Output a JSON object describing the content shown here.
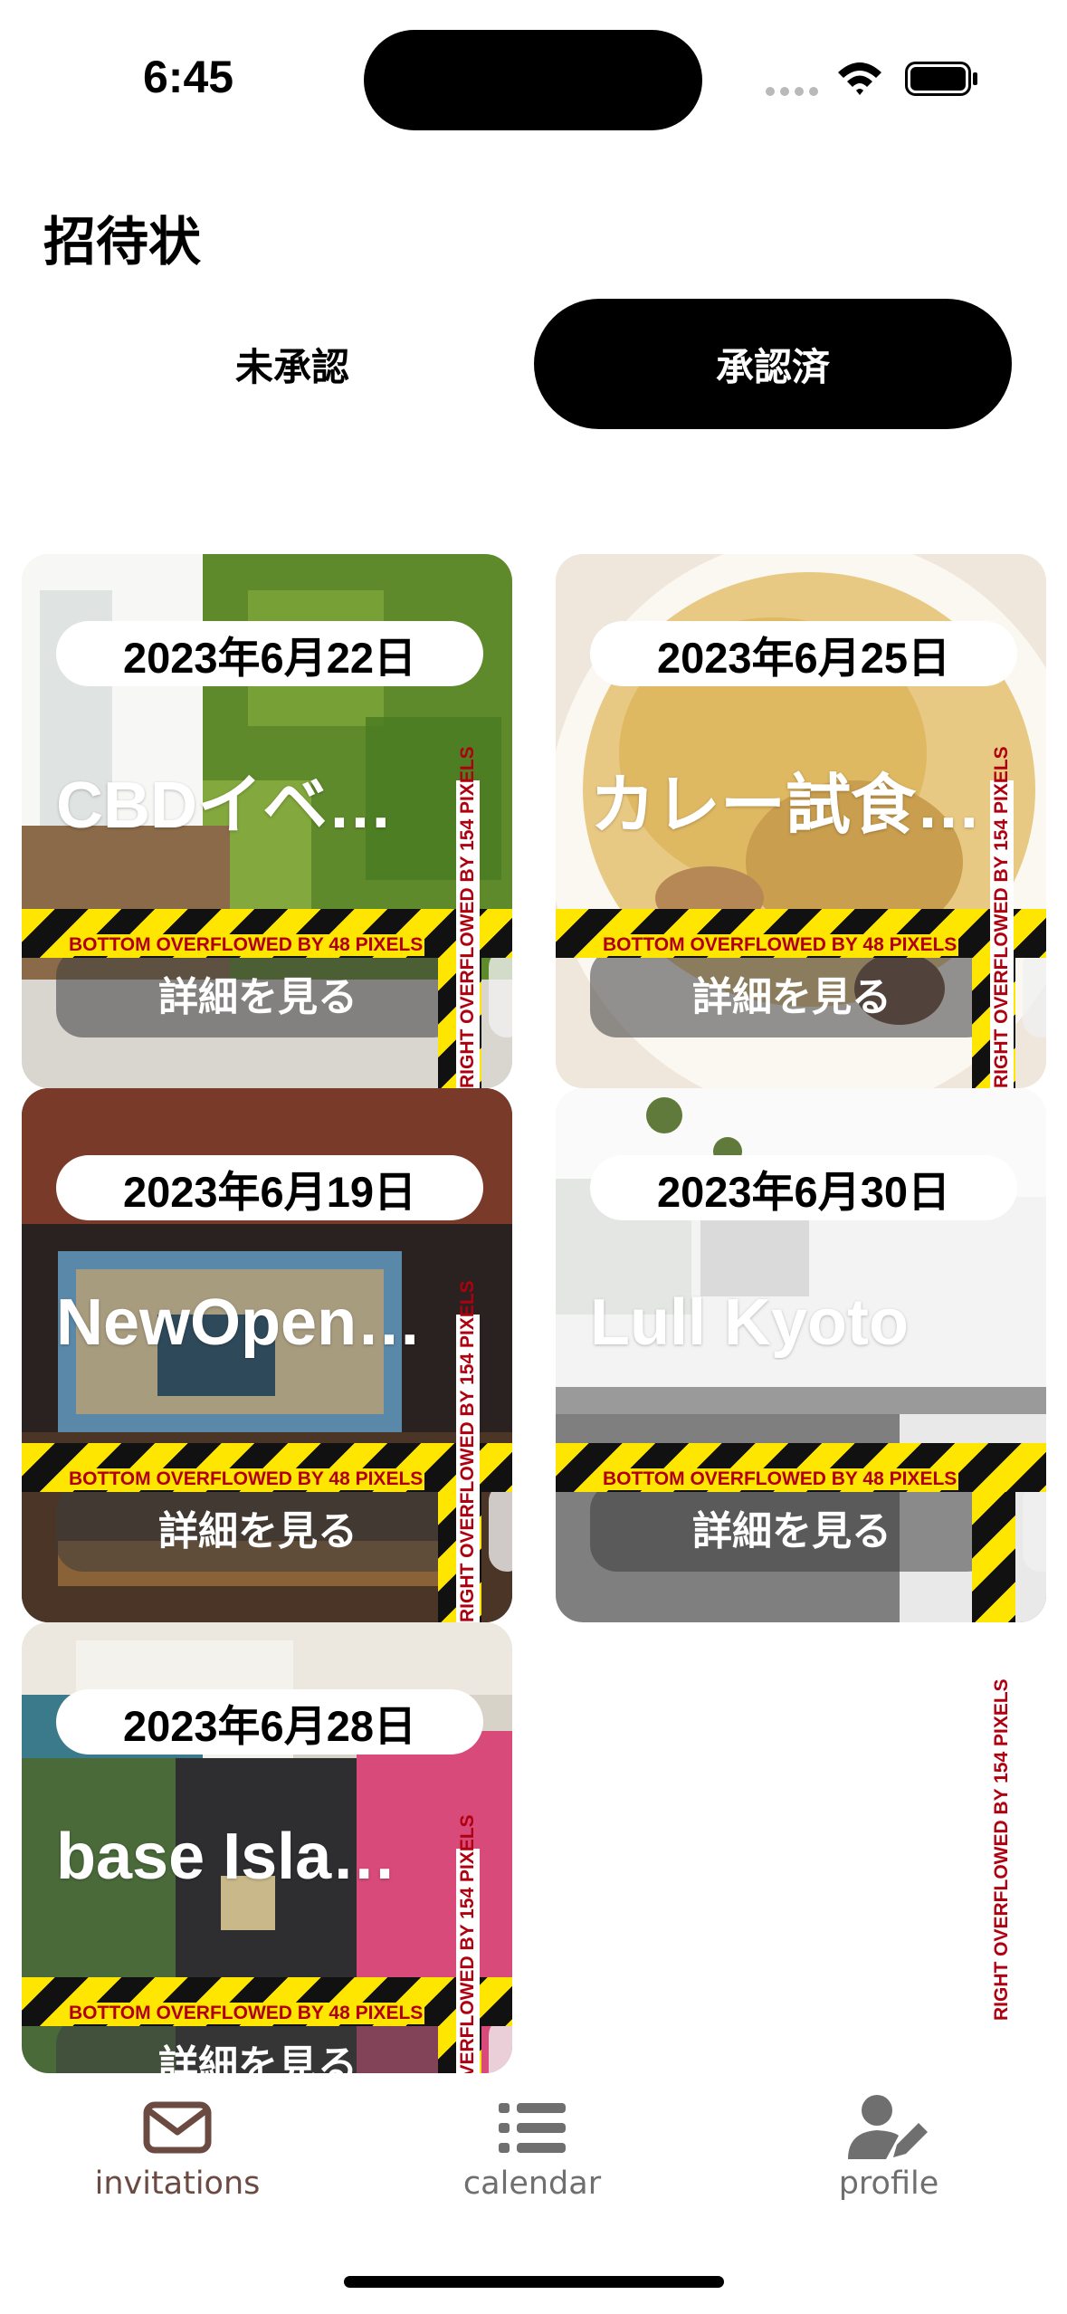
{
  "status": {
    "time": "6:45"
  },
  "header": {
    "title": "招待状"
  },
  "tabs": {
    "pending": "未承認",
    "approved": "承認済"
  },
  "cards": [
    {
      "date": "2023年6月22日",
      "title": "CBDイベ…",
      "button": "詳細を見る",
      "image": "cafe-green-wall"
    },
    {
      "date": "2023年6月25日",
      "title": "カレー試食…",
      "button": "詳細を見る",
      "image": "pasta-dish"
    },
    {
      "date": "2023年6月19日",
      "title": "NewOpen…",
      "button": "詳細を見る",
      "image": "cafe-bohemia-interior"
    },
    {
      "date": "2023年6月30日",
      "title": "Lull Kyoto",
      "button": "詳細を見る",
      "image": "white-kitchen-counter"
    },
    {
      "date": "2023年6月28日",
      "title": "base Isla…",
      "button": "詳細を見る",
      "image": "shop-entrance-open-sign"
    }
  ],
  "debug": {
    "overflow_bottom": "BOTTOM OVERFLOWED BY 48 PIXELS",
    "overflow_right": "RIGHT OVERFLOWED BY 154 PIXELS"
  },
  "nav": {
    "invitations": "invitations",
    "calendar": "calendar",
    "profile": "profile",
    "active": "invitations",
    "active_color": "#6b4a42",
    "inactive_color": "#6f6f6f"
  }
}
